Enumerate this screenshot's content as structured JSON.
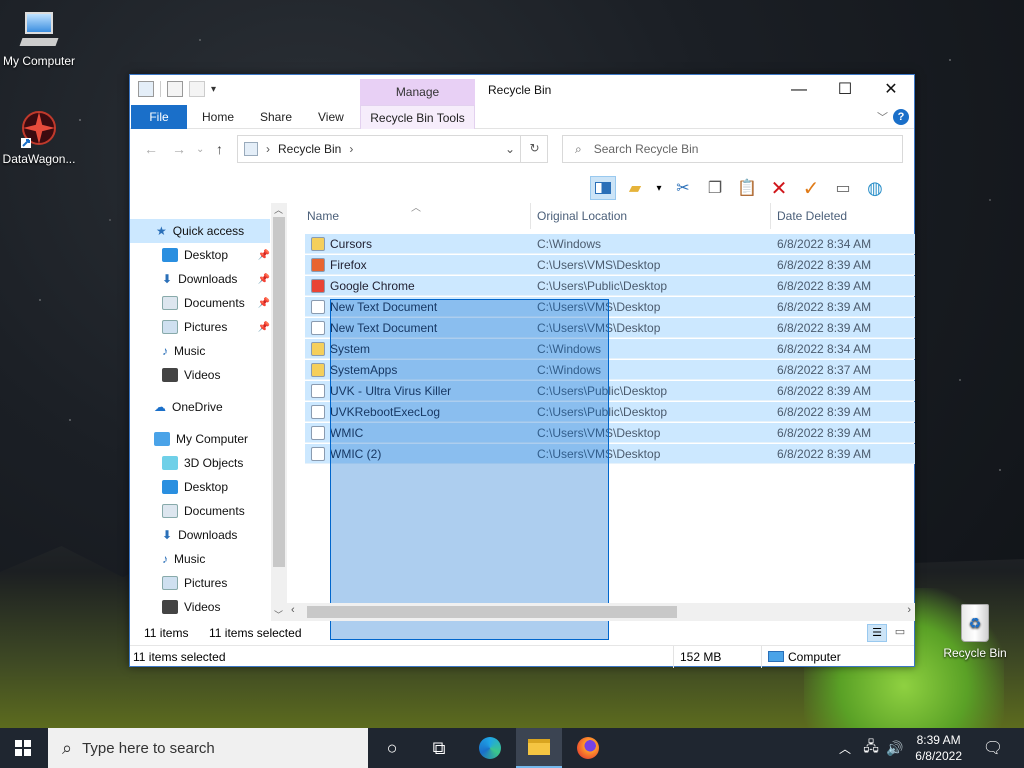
{
  "desktop": {
    "icons": [
      {
        "label": "My Computer"
      },
      {
        "label": "DataWagon..."
      },
      {
        "label": "Recycle Bin"
      }
    ]
  },
  "window": {
    "title": "Recycle Bin",
    "contextual_group": "Manage",
    "ribbon_tabs": [
      "File",
      "Home",
      "Share",
      "View",
      "Recycle Bin Tools"
    ],
    "address": "Recycle Bin",
    "search_placeholder": "Search Recycle Bin"
  },
  "nav": {
    "quick_access": "Quick access",
    "quick_items": [
      "Desktop",
      "Downloads",
      "Documents",
      "Pictures",
      "Music",
      "Videos"
    ],
    "onedrive": "OneDrive",
    "my_computer": "My Computer",
    "pc_items": [
      "3D Objects",
      "Desktop",
      "Documents",
      "Downloads",
      "Music",
      "Pictures",
      "Videos"
    ]
  },
  "columns": {
    "name": "Name",
    "location": "Original Location",
    "date": "Date Deleted"
  },
  "files": [
    {
      "name": "Cursors",
      "location": "C:\\Windows",
      "date": "6/8/2022 8:34 AM",
      "icon": "folder-icon",
      "color": "#f5cf5b"
    },
    {
      "name": "Firefox",
      "location": "C:\\Users\\VMS\\Desktop",
      "date": "6/8/2022 8:39 AM",
      "icon": "firefox-shortcut-icon",
      "color": "#e8642f"
    },
    {
      "name": "Google Chrome",
      "location": "C:\\Users\\Public\\Desktop",
      "date": "6/8/2022 8:39 AM",
      "icon": "chrome-shortcut-icon",
      "color": "#e94335"
    },
    {
      "name": "New Text Document",
      "location": "C:\\Users\\VMS\\Desktop",
      "date": "6/8/2022 8:39 AM",
      "icon": "text-file-icon",
      "color": "#ffffff"
    },
    {
      "name": "New Text Document",
      "location": "C:\\Users\\VMS\\Desktop",
      "date": "6/8/2022 8:39 AM",
      "icon": "text-file-icon",
      "color": "#ffffff"
    },
    {
      "name": "System",
      "location": "C:\\Windows",
      "date": "6/8/2022 8:34 AM",
      "icon": "folder-icon",
      "color": "#f5cf5b"
    },
    {
      "name": "SystemApps",
      "location": "C:\\Windows",
      "date": "6/8/2022 8:37 AM",
      "icon": "folder-icon",
      "color": "#f5cf5b"
    },
    {
      "name": "UVK - Ultra Virus Killer",
      "location": "C:\\Users\\Public\\Desktop",
      "date": "6/8/2022 8:39 AM",
      "icon": "shortcut-icon",
      "color": "#ffffff"
    },
    {
      "name": "UVKRebootExecLog",
      "location": "C:\\Users\\Public\\Desktop",
      "date": "6/8/2022 8:39 AM",
      "icon": "text-file-icon",
      "color": "#ffffff"
    },
    {
      "name": "WMIC",
      "location": "C:\\Users\\VMS\\Desktop",
      "date": "6/8/2022 8:39 AM",
      "icon": "shortcut-icon",
      "color": "#ffffff"
    },
    {
      "name": "WMIC (2)",
      "location": "C:\\Users\\VMS\\Desktop",
      "date": "6/8/2022 8:39 AM",
      "icon": "shortcut-icon",
      "color": "#ffffff"
    }
  ],
  "view_status": {
    "count": "11 items",
    "selected": "11 items selected"
  },
  "statusbar": {
    "selected": "11 items selected",
    "size": "152 MB",
    "location": "Computer"
  },
  "taskbar": {
    "search_placeholder": "Type here to search",
    "time": "8:39 AM",
    "date": "6/8/2022"
  },
  "colors": {
    "accent": "#1a6fc9",
    "selection": "#cce8ff",
    "manage_tab": "#e8d0f5"
  }
}
